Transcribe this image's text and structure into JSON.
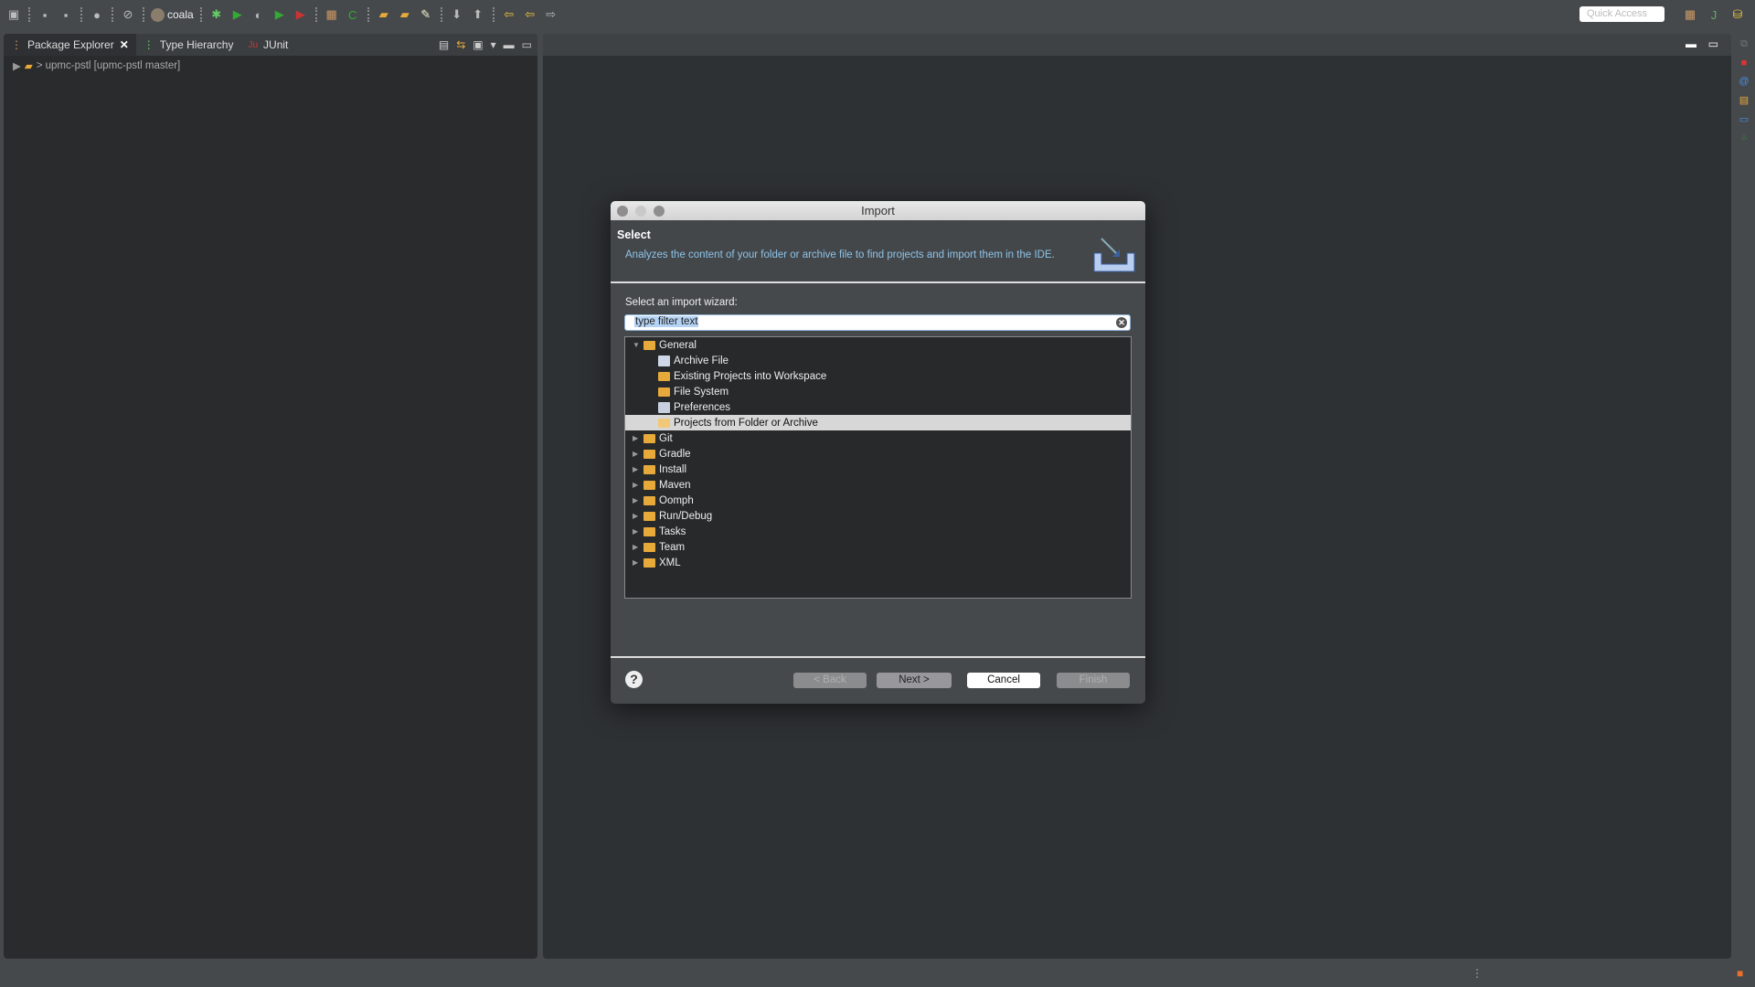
{
  "toolbar": {
    "run_config": "coala",
    "quick_access_placeholder": "Quick Access",
    "icons": [
      "new-wizard-icon",
      "save-icon",
      "save-all-icon",
      "profile-icon",
      "skip-breakpoints-icon",
      "debug-icon",
      "run-icon",
      "coverage-icon",
      "run-last-icon",
      "run-external-icon",
      "new-package-icon",
      "new-class-icon",
      "open-type-icon",
      "open-task-icon",
      "search-icon",
      "next-annotation-icon",
      "prev-annotation-icon",
      "last-edit-icon",
      "back-icon",
      "forward-icon"
    ]
  },
  "left_panel": {
    "tabs": [
      {
        "label": "Package Explorer",
        "active": true
      },
      {
        "label": "Type Hierarchy"
      },
      {
        "label": "JUnit"
      }
    ],
    "project": "> upmc-pstl [upmc-pstl master]"
  },
  "dialog": {
    "title": "Import",
    "header_title": "Select",
    "header_desc": "Analyzes the content of your folder or archive file to find projects and import them in the IDE.",
    "wizard_label": "Select an import wizard:",
    "filter_placeholder": "type filter text",
    "tree": [
      {
        "label": "General",
        "expanded": true,
        "children": [
          "Archive File",
          "Existing Projects into Workspace",
          "File System",
          "Preferences",
          "Projects from Folder or Archive"
        ],
        "selected": "Projects from Folder or Archive"
      },
      {
        "label": "Git"
      },
      {
        "label": "Gradle"
      },
      {
        "label": "Install"
      },
      {
        "label": "Maven"
      },
      {
        "label": "Oomph"
      },
      {
        "label": "Run/Debug"
      },
      {
        "label": "Tasks"
      },
      {
        "label": "Team"
      },
      {
        "label": "XML"
      }
    ],
    "buttons": {
      "back": "< Back",
      "next": "Next >",
      "cancel": "Cancel",
      "finish": "Finish"
    },
    "help": "?"
  }
}
